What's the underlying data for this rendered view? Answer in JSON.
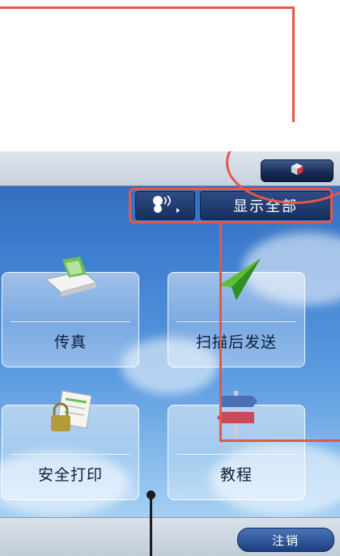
{
  "toolbar": {
    "home_icon": "box-icon",
    "network_icon": "network-signal-icon",
    "show_all_label": "显示全部"
  },
  "tiles": [
    {
      "label": "传真",
      "icon": "fax-icon"
    },
    {
      "label": "扫描后发送",
      "icon": "paper-plane-icon"
    },
    {
      "label": "安全打印",
      "icon": "lock-document-icon"
    },
    {
      "label": "教程",
      "icon": "signpost-icon"
    }
  ],
  "footer": {
    "logout_label": "注销"
  },
  "colors": {
    "callout": "#e8554a",
    "accent_dark": "#16305f"
  }
}
